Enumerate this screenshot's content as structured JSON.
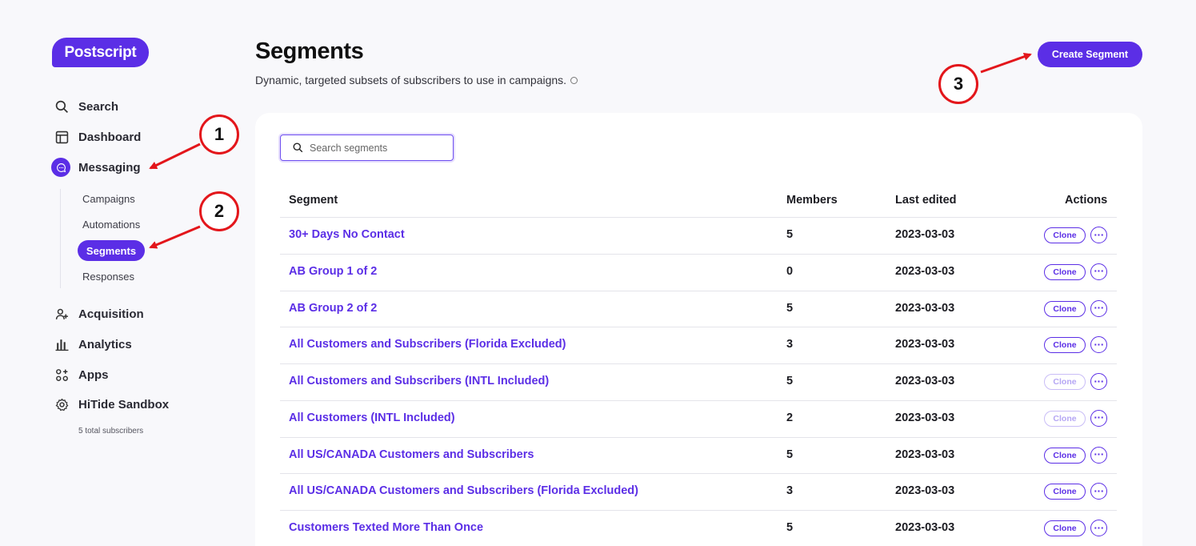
{
  "brand": {
    "logo": "Postscript",
    "accent": "#5b2ee6",
    "annotation_color": "#e3161b"
  },
  "sidebar": {
    "items": [
      {
        "label": "Search",
        "icon": "search-icon"
      },
      {
        "label": "Dashboard",
        "icon": "dashboard-icon"
      },
      {
        "label": "Messaging",
        "icon": "message-icon"
      },
      {
        "label": "Acquisition",
        "icon": "user-add-icon"
      },
      {
        "label": "Analytics",
        "icon": "bar-chart-icon"
      },
      {
        "label": "Apps",
        "icon": "apps-icon"
      },
      {
        "label": "HiTide Sandbox",
        "icon": "gear-icon"
      }
    ],
    "messaging_sub": [
      "Campaigns",
      "Automations",
      "Segments",
      "Responses"
    ],
    "active_sub": "Segments",
    "subscribers_note": "5 total subscribers"
  },
  "header": {
    "title": "Segments",
    "subtitle": "Dynamic, targeted subsets of subscribers to use in campaigns.",
    "create_button": "Create Segment"
  },
  "search": {
    "placeholder": "Search segments",
    "value": ""
  },
  "table": {
    "headers": [
      "Segment",
      "Members",
      "Last edited",
      "Actions"
    ],
    "action_label": "Clone",
    "more_label": "···",
    "rows": [
      {
        "name": "30+ Days No Contact",
        "members": "5",
        "edited": "2023-03-03",
        "clone_enabled": true
      },
      {
        "name": "AB Group 1 of 2",
        "members": "0",
        "edited": "2023-03-03",
        "clone_enabled": true
      },
      {
        "name": "AB Group 2 of 2",
        "members": "5",
        "edited": "2023-03-03",
        "clone_enabled": true
      },
      {
        "name": "All Customers and Subscribers (Florida Excluded)",
        "members": "3",
        "edited": "2023-03-03",
        "clone_enabled": true
      },
      {
        "name": "All Customers and Subscribers (INTL Included)",
        "members": "5",
        "edited": "2023-03-03",
        "clone_enabled": false
      },
      {
        "name": "All Customers (INTL Included)",
        "members": "2",
        "edited": "2023-03-03",
        "clone_enabled": false
      },
      {
        "name": "All US/CANADA Customers and Subscribers",
        "members": "5",
        "edited": "2023-03-03",
        "clone_enabled": true
      },
      {
        "name": "All US/CANADA Customers and Subscribers (Florida Excluded)",
        "members": "3",
        "edited": "2023-03-03",
        "clone_enabled": true
      },
      {
        "name": "Customers Texted More Than Once",
        "members": "5",
        "edited": "2023-03-03",
        "clone_enabled": true
      }
    ]
  },
  "annotations": [
    "1",
    "2",
    "3"
  ]
}
